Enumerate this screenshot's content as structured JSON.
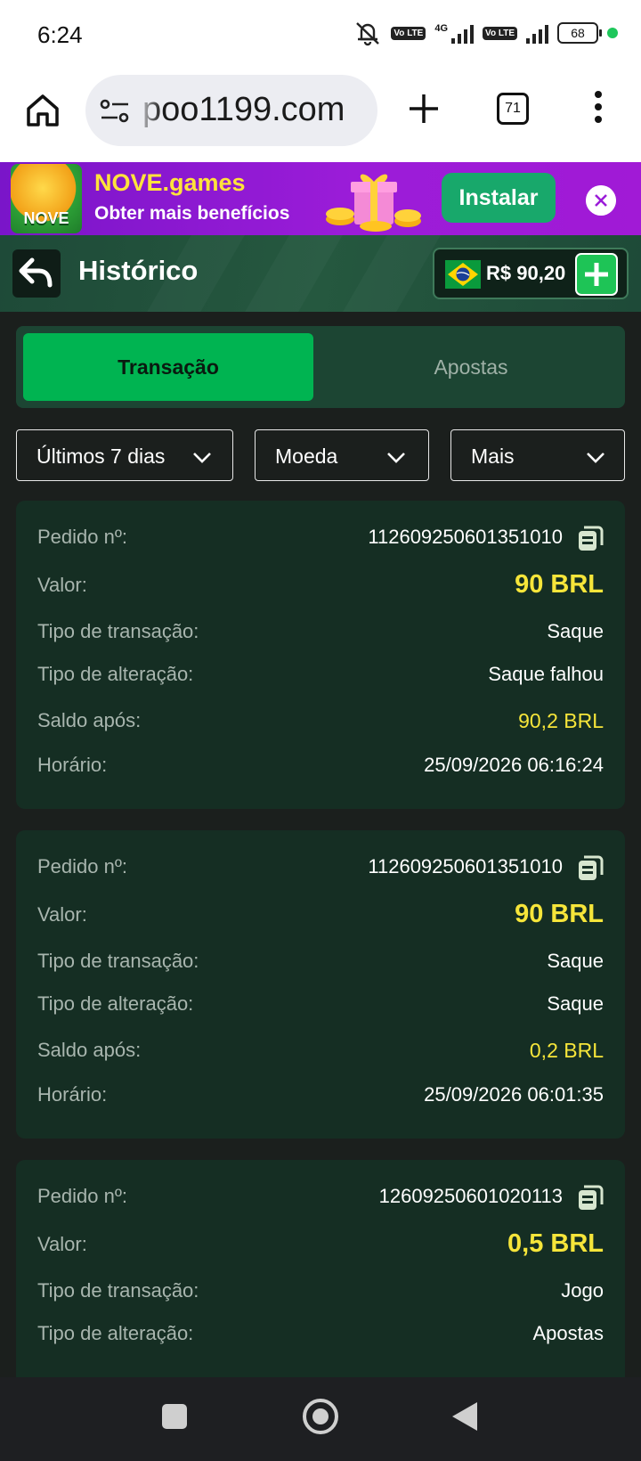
{
  "status_bar": {
    "time": "6:24",
    "network_label": "4G",
    "volte_label": "Vo LTE",
    "battery": "68"
  },
  "browser": {
    "url": "poo1199.com",
    "tab_count": "71"
  },
  "promo": {
    "title": "NOVE.games",
    "subtitle": "Obter mais benefícios",
    "logo_text": "NOVE",
    "install_label": "Instalar"
  },
  "header": {
    "title": "Histórico",
    "balance": "R$ 90,20"
  },
  "tabs": {
    "active": "Transação",
    "inactive": "Apostas"
  },
  "filters": {
    "period": "Últimos 7 dias",
    "currency": "Moeda",
    "more": "Mais"
  },
  "labels": {
    "order": "Pedido nº:",
    "value": "Valor:",
    "transaction_type": "Tipo de transação:",
    "change_type": "Tipo de alteração:",
    "balance_after": "Saldo após:",
    "time": "Horário:"
  },
  "transactions": [
    {
      "order": "112609250601351010",
      "value": "90 BRL",
      "transaction_type": "Saque",
      "change_type": "Saque falhou",
      "balance_after": "90,2 BRL",
      "time": "25/09/2026 06:16:24"
    },
    {
      "order": "112609250601351010",
      "value": "90 BRL",
      "transaction_type": "Saque",
      "change_type": "Saque",
      "balance_after": "0,2 BRL",
      "time": "25/09/2026 06:01:35"
    },
    {
      "order": "12609250601020113",
      "value": "0,5 BRL",
      "transaction_type": "Jogo",
      "change_type": "Apostas"
    }
  ],
  "colors": {
    "accent_green": "#00b451",
    "value_yellow": "#f6e53a",
    "card_bg": "#152e23",
    "promo_purple": "#9b1cd8"
  }
}
